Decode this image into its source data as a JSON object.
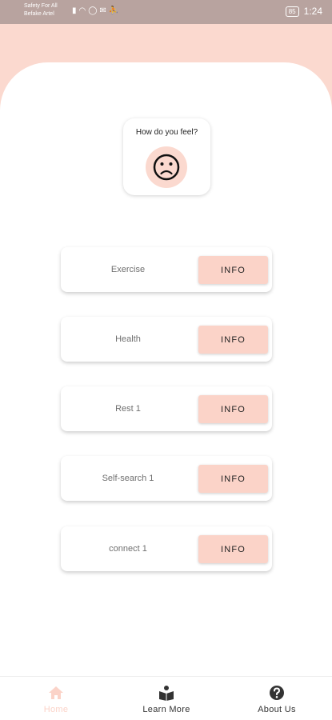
{
  "status_bar": {
    "carrier_line1": "Safety For All",
    "carrier_line2": "Befake Artel",
    "icons": [
      "signal-icon",
      "wifi-icon",
      "whatsapp-icon",
      "mail-icon",
      "runner-icon"
    ],
    "battery": "85",
    "time": "1:24"
  },
  "mood": {
    "question": "How do you feel?",
    "face_icon": "sad-face-icon"
  },
  "items": [
    {
      "label": "Exercise",
      "button": "INFO"
    },
    {
      "label": "Health",
      "button": "INFO"
    },
    {
      "label": "Rest 1",
      "button": "INFO"
    },
    {
      "label": "Self-search 1",
      "button": "INFO"
    },
    {
      "label": "connect 1",
      "button": "INFO"
    }
  ],
  "bottom_nav": {
    "items": [
      {
        "label": "Home",
        "icon": "home-icon",
        "active": true
      },
      {
        "label": "Learn More",
        "icon": "book-reader-icon",
        "active": false
      },
      {
        "label": "About Us",
        "icon": "question-circle-icon",
        "active": false
      }
    ]
  },
  "colors": {
    "accent": "#fbd3c8",
    "header_bg": "#fbd9cf",
    "status_bar": "#b8a39f"
  }
}
